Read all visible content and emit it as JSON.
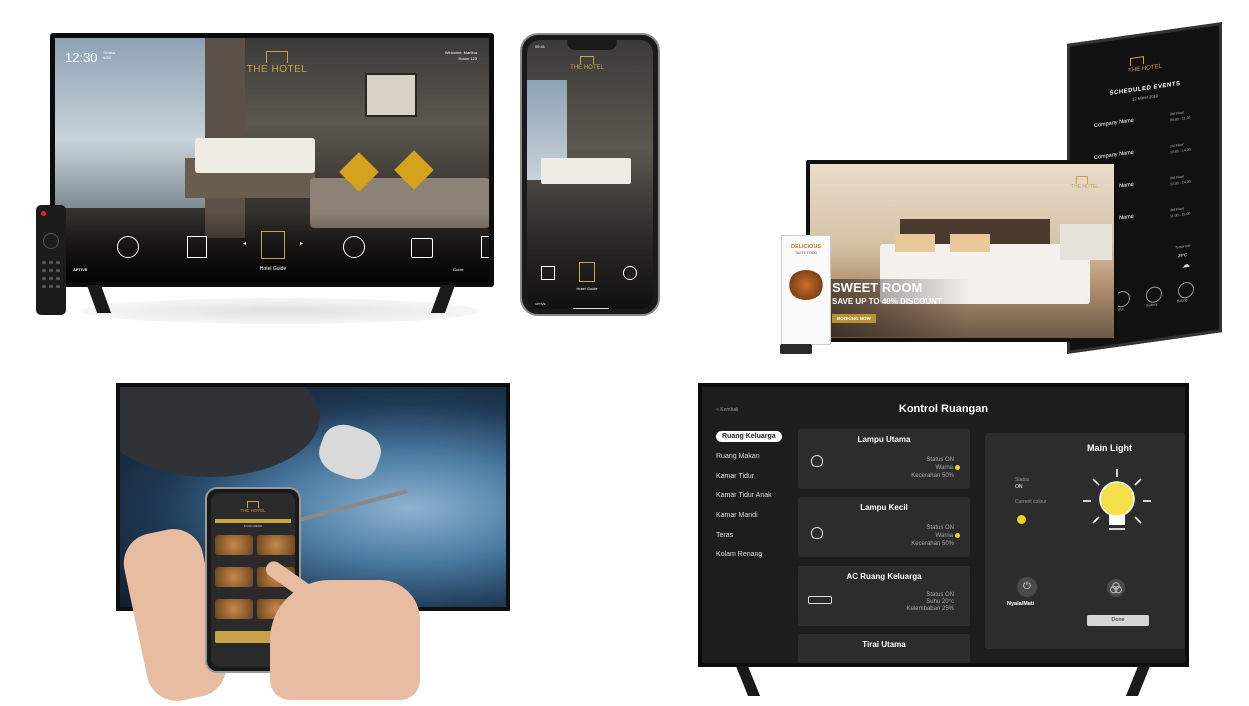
{
  "tv_hotel_guide": {
    "time": "12:30",
    "date": "Selasa 6/24",
    "welcome": "Welcome, Martina",
    "room": "Room 123",
    "logo": "THE HOTEL",
    "selected_label": "Hotel Guide",
    "guide_label": "Guide",
    "brand": "APTIVE",
    "icons": [
      "play-icon",
      "film-icon",
      "hotel-guide-icon",
      "dining-icon",
      "luggage-icon"
    ]
  },
  "phone_hotel_guide": {
    "time": "09:41",
    "logo": "THE HOTEL",
    "selected_label": "Hotel Guide",
    "brand": "APTIVE"
  },
  "signage": {
    "portrait": {
      "logo": "THE HOTEL",
      "title": "SCHEDULED EVENTS",
      "date": "12 Maret 2019",
      "events": [
        {
          "company": "Company Name",
          "location": "3rd Floor",
          "time": "09.00 - 11.30"
        },
        {
          "company": "Company Name",
          "location": "1st Floor",
          "time": "10.00 - 14.00"
        },
        {
          "company": "Company Name",
          "location": "3rd Floor",
          "time": "10.00 - 14.00"
        },
        {
          "company": "Company Name",
          "location": "3rd Floor",
          "time": "11.00 - 15.00"
        }
      ],
      "weather_label": "Tomorrow",
      "weather_temp": "29°C",
      "clocks": [
        "Jakarta",
        "Sydney",
        "Beijing"
      ]
    },
    "landscape": {
      "logo": "THE HOTEL",
      "headline": "SWEET ROOM",
      "offer_prefix": "SAVE UP TO",
      "offer_value": "40% DISCOUNT",
      "cta": "BOOKING NOW"
    },
    "kiosk": {
      "title": "DELICIOUS",
      "subtitle": "TASTE FOOD"
    }
  },
  "tv_cast": {
    "phone_logo": "THE HOTEL",
    "phone_header": "FOOD MENU"
  },
  "room_control": {
    "back_label": "< Kembali",
    "title": "Kontrol Ruangan",
    "rooms": [
      "Ruang Keluarga",
      "Ruang Makan",
      "Kamar Tidur",
      "Kamar Tidur Anak",
      "Kamar Mandi",
      "Teras",
      "Kolam Renang"
    ],
    "active_room": "Ruang Keluarga",
    "devices": [
      {
        "name": "Lampu Utama",
        "lines": [
          "Status ON",
          "Warna",
          "Kecerahan 50%"
        ]
      },
      {
        "name": "Lampu Kecil",
        "lines": [
          "Status ON",
          "Warna",
          "Kecerahan 50%"
        ]
      },
      {
        "name": "AC Ruang Keluarga",
        "lines": [
          "Status ON",
          "Suhu 20°c",
          "Kelembaban 25%"
        ]
      },
      {
        "name": "Tirai Utama",
        "lines": []
      }
    ],
    "panel": {
      "title": "Main Light",
      "status_label": "Status",
      "status_value": "ON",
      "color_label": "Current colour",
      "power_label": "Nyala/Mati",
      "done_label": "Done"
    },
    "colors": {
      "accent": "#f0d021",
      "panel": "#2c2c2c",
      "bg": "#1d1d1d"
    }
  }
}
